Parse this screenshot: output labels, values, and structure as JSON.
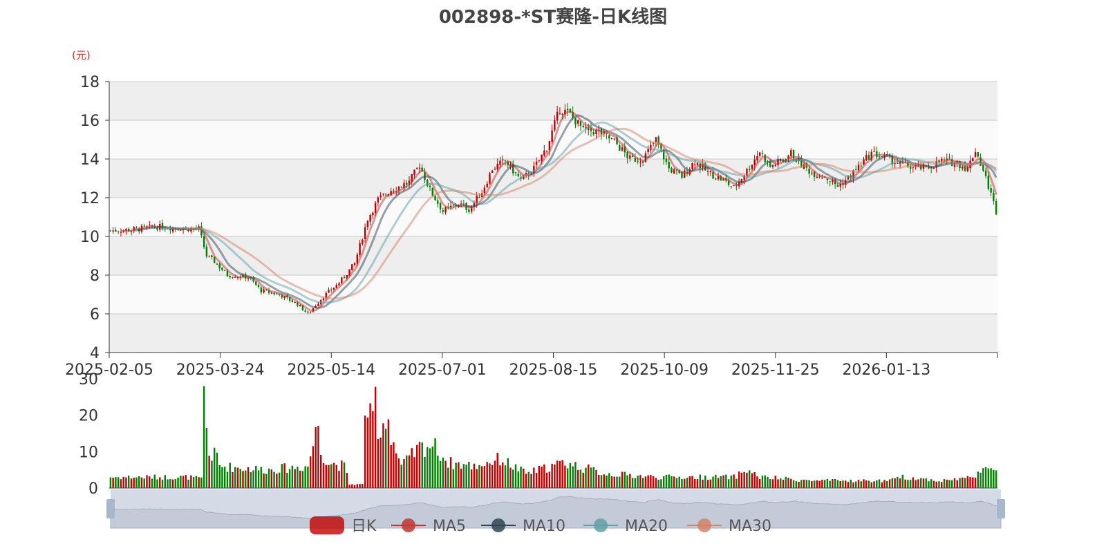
{
  "title": "002898-*ST赛隆-日K线图",
  "unit": "(元)",
  "legend": [
    {
      "label": "日K",
      "color": "#c00000"
    },
    {
      "label": "MA5",
      "color": "#c23531"
    },
    {
      "label": "MA10",
      "color": "#2f4554"
    },
    {
      "label": "MA20",
      "color": "#61a0a8"
    },
    {
      "label": "MA30",
      "color": "#d48265"
    }
  ],
  "colors": {
    "up": "#c00000",
    "down": "#008000",
    "band": "#eeeeee",
    "slider_bg": "#d5dbe6",
    "slider_handle": "#a7b7cc"
  },
  "chart_data": {
    "type": "candlestick",
    "title": "002898-*ST赛隆-日K线图",
    "y_unit": "(元)",
    "price_axis": {
      "min": 4,
      "max": 18,
      "ticks": [
        4,
        6,
        8,
        10,
        12,
        14,
        16,
        18
      ]
    },
    "volume_axis": {
      "min": 0,
      "max": 30,
      "ticks": [
        0,
        10,
        20,
        30
      ]
    },
    "x_ticks": [
      "2025-02-05",
      "2025-03-24",
      "2025-05-14",
      "2025-07-01",
      "2025-08-15",
      "2025-10-09",
      "2025-11-25",
      "2026-01-13"
    ],
    "grid": true,
    "legend_position": "bottom",
    "price_path_anchors": [
      {
        "i": 0,
        "close": 10.3
      },
      {
        "i": 8,
        "close": 10.35
      },
      {
        "i": 18,
        "close": 10.5
      },
      {
        "i": 30,
        "close": 10.4
      },
      {
        "i": 34,
        "close": 10.4
      },
      {
        "i": 37,
        "close": 9.0
      },
      {
        "i": 40,
        "close": 8.7
      },
      {
        "i": 45,
        "close": 8.0
      },
      {
        "i": 53,
        "close": 7.9
      },
      {
        "i": 58,
        "close": 7.2
      },
      {
        "i": 65,
        "close": 7.0
      },
      {
        "i": 72,
        "close": 6.5
      },
      {
        "i": 76,
        "close": 6.0
      },
      {
        "i": 82,
        "close": 6.9
      },
      {
        "i": 88,
        "close": 7.6
      },
      {
        "i": 94,
        "close": 8.6
      },
      {
        "i": 99,
        "close": 10.9
      },
      {
        "i": 103,
        "close": 11.9
      },
      {
        "i": 108,
        "close": 12.4
      },
      {
        "i": 115,
        "close": 12.8
      },
      {
        "i": 119,
        "close": 13.7
      },
      {
        "i": 123,
        "close": 12.4
      },
      {
        "i": 128,
        "close": 11.3
      },
      {
        "i": 134,
        "close": 11.7
      },
      {
        "i": 138,
        "close": 11.4
      },
      {
        "i": 143,
        "close": 12.3
      },
      {
        "i": 147,
        "close": 13.5
      },
      {
        "i": 152,
        "close": 13.9
      },
      {
        "i": 158,
        "close": 12.9
      },
      {
        "i": 163,
        "close": 13.5
      },
      {
        "i": 168,
        "close": 14.6
      },
      {
        "i": 173,
        "close": 16.6
      },
      {
        "i": 177,
        "close": 16.3
      },
      {
        "i": 182,
        "close": 15.5
      },
      {
        "i": 188,
        "close": 15.4
      },
      {
        "i": 194,
        "close": 14.9
      },
      {
        "i": 200,
        "close": 14.0
      },
      {
        "i": 205,
        "close": 14.0
      },
      {
        "i": 210,
        "close": 15.0
      },
      {
        "i": 215,
        "close": 13.5
      },
      {
        "i": 220,
        "close": 13.1
      },
      {
        "i": 225,
        "close": 13.9
      },
      {
        "i": 230,
        "close": 13.3
      },
      {
        "i": 236,
        "close": 12.9
      },
      {
        "i": 240,
        "close": 12.5
      },
      {
        "i": 245,
        "close": 13.4
      },
      {
        "i": 250,
        "close": 14.4
      },
      {
        "i": 254,
        "close": 13.6
      },
      {
        "i": 258,
        "close": 13.9
      },
      {
        "i": 262,
        "close": 14.3
      },
      {
        "i": 266,
        "close": 13.7
      },
      {
        "i": 270,
        "close": 13.3
      },
      {
        "i": 275,
        "close": 13.1
      },
      {
        "i": 280,
        "close": 12.6
      },
      {
        "i": 284,
        "close": 13.0
      },
      {
        "i": 288,
        "close": 13.6
      },
      {
        "i": 293,
        "close": 14.3
      },
      {
        "i": 298,
        "close": 14.1
      },
      {
        "i": 303,
        "close": 13.8
      },
      {
        "i": 308,
        "close": 13.6
      },
      {
        "i": 314,
        "close": 13.5
      },
      {
        "i": 320,
        "close": 13.9
      },
      {
        "i": 326,
        "close": 13.8
      },
      {
        "i": 330,
        "close": 13.5
      },
      {
        "i": 333,
        "close": 14.5
      },
      {
        "i": 336,
        "close": 13.4
      },
      {
        "i": 338,
        "close": 12.6
      },
      {
        "i": 341,
        "close": 11.3
      }
    ],
    "volume_anchors": [
      {
        "i": 0,
        "v": 3
      },
      {
        "i": 30,
        "v": 3
      },
      {
        "i": 35,
        "v": 2.5
      },
      {
        "i": 36,
        "v": 26
      },
      {
        "i": 37,
        "v": 17
      },
      {
        "i": 38,
        "v": 9
      },
      {
        "i": 41,
        "v": 9
      },
      {
        "i": 42,
        "v": 6
      },
      {
        "i": 60,
        "v": 5
      },
      {
        "i": 76,
        "v": 6
      },
      {
        "i": 80,
        "v": 18
      },
      {
        "i": 81,
        "v": 10
      },
      {
        "i": 84,
        "v": 7
      },
      {
        "i": 90,
        "v": 6
      },
      {
        "i": 92,
        "v": 1
      },
      {
        "i": 97,
        "v": 1
      },
      {
        "i": 98,
        "v": 23
      },
      {
        "i": 101,
        "v": 17
      },
      {
        "i": 102,
        "v": 27
      },
      {
        "i": 103,
        "v": 12
      },
      {
        "i": 104,
        "v": 18
      },
      {
        "i": 107,
        "v": 19
      },
      {
        "i": 108,
        "v": 15
      },
      {
        "i": 110,
        "v": 10
      },
      {
        "i": 112,
        "v": 6
      },
      {
        "i": 119,
        "v": 11
      },
      {
        "i": 124,
        "v": 12
      },
      {
        "i": 130,
        "v": 7
      },
      {
        "i": 140,
        "v": 6
      },
      {
        "i": 150,
        "v": 8
      },
      {
        "i": 160,
        "v": 4
      },
      {
        "i": 175,
        "v": 7
      },
      {
        "i": 190,
        "v": 4
      },
      {
        "i": 210,
        "v": 3
      },
      {
        "i": 240,
        "v": 3
      },
      {
        "i": 245,
        "v": 5
      },
      {
        "i": 250,
        "v": 3
      },
      {
        "i": 270,
        "v": 2
      },
      {
        "i": 300,
        "v": 2
      },
      {
        "i": 305,
        "v": 3
      },
      {
        "i": 320,
        "v": 2
      },
      {
        "i": 332,
        "v": 3
      },
      {
        "i": 336,
        "v": 6
      },
      {
        "i": 341,
        "v": 4
      }
    ]
  }
}
